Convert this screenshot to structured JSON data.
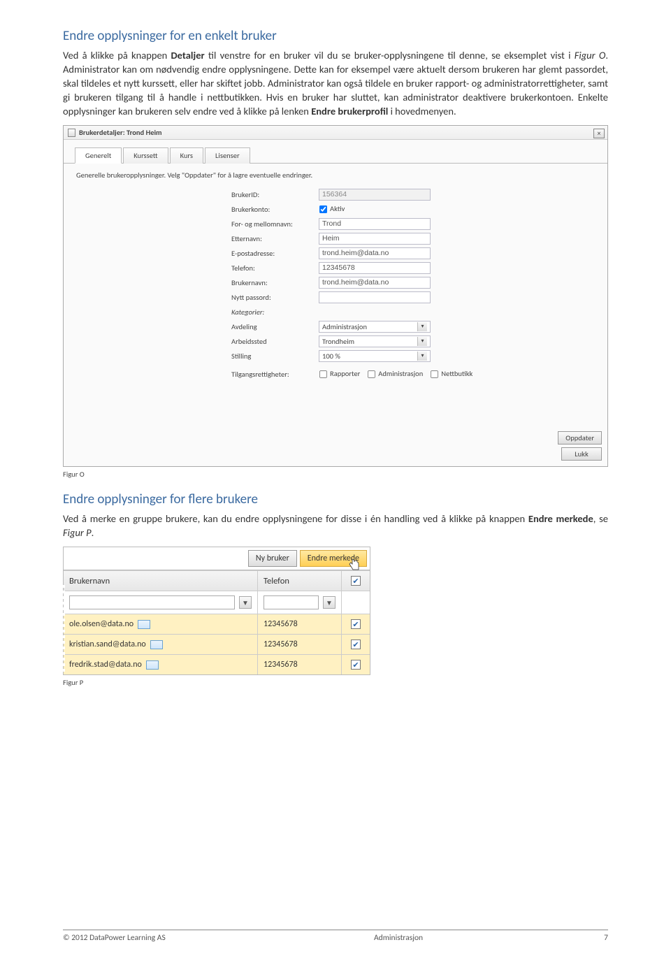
{
  "section1": {
    "heading": "Endre opplysninger for en enkelt bruker",
    "p1a": "Ved å klikke på knappen ",
    "p1b": "Detaljer",
    "p1c": " til venstre for en bruker vil du se bruker-opplysningene til denne, se eksemplet vist i ",
    "p1d": "Figur O",
    "p1e": ". Administrator kan om nødvendig endre opplysningene. Dette kan for eksempel være aktuelt dersom brukeren har glemt passordet, skal tildeles et nytt kurssett, eller har skiftet jobb. Administrator kan også tildele en bruker rapport- og administratorrettigheter, samt gi brukeren tilgang til å handle i nettbutikken. Hvis en bruker har sluttet, kan administrator deaktivere brukerkontoen. Enkelte opplysninger kan brukeren selv endre ved å klikke på lenken ",
    "p1f": "Endre brukerprofil",
    "p1g": " i hovedmenyen."
  },
  "dialog": {
    "title": "Brukerdetaljer: Trond Heim",
    "close": "×",
    "tabs": {
      "t1": "Generelt",
      "t2": "Kurssett",
      "t3": "Kurs",
      "t4": "Lisenser"
    },
    "desc": "Generelle brukeropplysninger. Velg \"Oppdater\" for å lagre eventuelle endringer.",
    "labels": {
      "brukerid": "BrukerID:",
      "brukerkonto": "Brukerkonto:",
      "aktiv": "Aktiv",
      "fornavn": "For- og mellomnavn:",
      "etternavn": "Etternavn:",
      "epost": "E-postadresse:",
      "telefon": "Telefon:",
      "brukernavn": "Brukernavn:",
      "nyttpass": "Nytt passord:",
      "kategorier": "Kategorier:",
      "avdeling": "Avdeling",
      "arbeidssted": "Arbeidssted",
      "stilling": "Stilling",
      "tilgang": "Tilgangsrettigheter:",
      "rapporter": "Rapporter",
      "administrasjon": "Administrasjon",
      "nettbutikk": "Nettbutikk"
    },
    "values": {
      "brukerid": "156364",
      "fornavn": "Trond",
      "etternavn": "Heim",
      "epost": "trond.heim@data.no",
      "telefon": "12345678",
      "brukernavn": "trond.heim@data.no",
      "nyttpass": "",
      "avdeling": "Administrasjon",
      "arbeidssted": "Trondheim",
      "stilling": "100 %"
    },
    "buttons": {
      "update": "Oppdater",
      "close_btn": "Lukk"
    }
  },
  "captionO": "Figur O",
  "section2": {
    "heading": "Endre opplysninger for flere brukere",
    "p1a": "Ved å merke en gruppe brukere, kan du endre opplysningene for disse i én handling ved å klikke på knappen ",
    "p1b": "Endre merkede",
    "p1c": ", se ",
    "p1d": "Figur P",
    "p1e": "."
  },
  "grid": {
    "btn_ny": "Ny bruker",
    "btn_endre": "Endre merkede",
    "col_brukernavn": "Brukernavn",
    "col_telefon": "Telefon",
    "rows": [
      {
        "navn": "ole.olsen@data.no",
        "tlf": "12345678",
        "sel": true
      },
      {
        "navn": "kristian.sand@data.no",
        "tlf": "12345678",
        "sel": true
      },
      {
        "navn": "fredrik.stad@data.no",
        "tlf": "12345678",
        "sel": true
      }
    ]
  },
  "captionP": "Figur P",
  "footer": {
    "copy": "© 2012 DataPower Learning AS",
    "title": "Administrasjon",
    "page": "7"
  }
}
